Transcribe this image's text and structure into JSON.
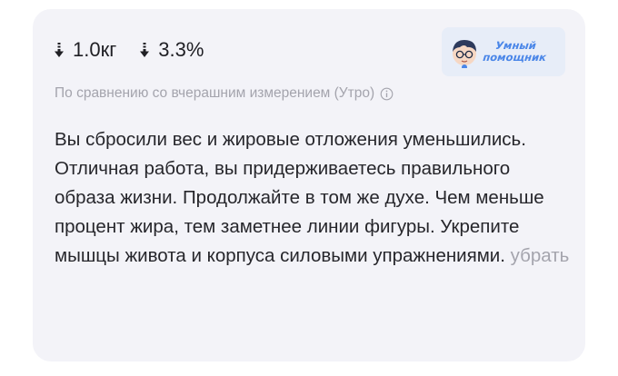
{
  "metrics": {
    "weight_change": "1.0кг",
    "fat_change": "3.3%"
  },
  "comparison_note": "По сравнению со вчерашним измерением (Утро)",
  "badge": {
    "line1": "Умный",
    "line2": "помощник",
    "color": "#4a86e8"
  },
  "message": {
    "text": "Вы сбросили вес и жировые отложения уменьшились. Отличная работа, вы придерживаетесь правильного образа жизни. Продолжайте в том же духе. Чем меньше процент жира, тем заметнее линии фигуры. Укрепите мышцы живота и корпуса силовыми упражнениями.",
    "remove_label": "убрать"
  },
  "colors": {
    "card_bg": "#f3f3f8",
    "muted_text": "#a4a4ad",
    "main_text": "#26262b"
  }
}
